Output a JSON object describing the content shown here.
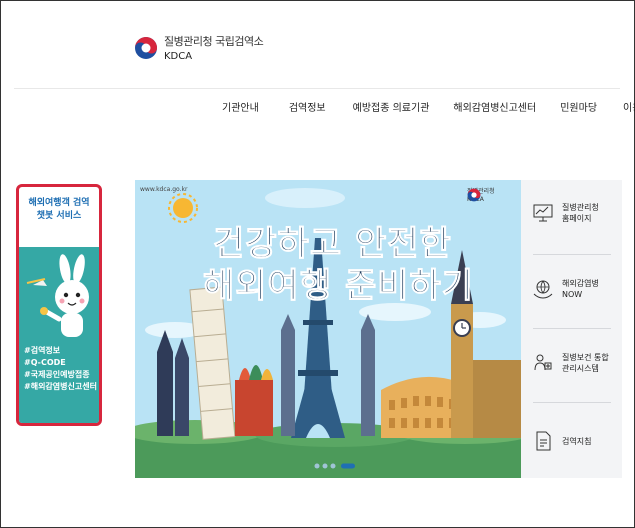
{
  "header": {
    "logo_ko": "질병관리청 국립검역소",
    "logo_en": "KDCA",
    "nav": [
      "기관안내",
      "검역정보",
      "예방접종 의료기관",
      "해외감염병신고센터",
      "민원마당",
      "이용안내"
    ]
  },
  "chatbot": {
    "title": "해외여행객 검역\n챗봇 서비스",
    "tags": [
      "#검역정보",
      "#Q-CODE",
      "#국제공인예방접종",
      "#해외감염병신고센터"
    ]
  },
  "banner": {
    "url": "www.kdca.go.kr",
    "logo_ko": "질병관리청",
    "logo_en": "KDCA",
    "headline_1": "건강하고 안전한",
    "headline_2": "해외여행 준비하기",
    "active_slide": 3,
    "slide_count": 4
  },
  "quick_menu": [
    {
      "label": "질병관리청\n홈페이지",
      "icon": "monitor-chart-icon"
    },
    {
      "label": "해외감염병\nNOW",
      "icon": "globe-hands-icon"
    },
    {
      "label": "질병보건 통합\n관리시스템",
      "icon": "people-cross-icon"
    },
    {
      "label": "검역지침",
      "icon": "document-icon"
    }
  ],
  "colors": {
    "brand_red": "#d7263d",
    "brand_blue": "#1f6fb3",
    "chatbot_teal": "#35a8a5",
    "banner_sky": "#b9e3f5",
    "headline_navy": "#1b3a5c"
  }
}
